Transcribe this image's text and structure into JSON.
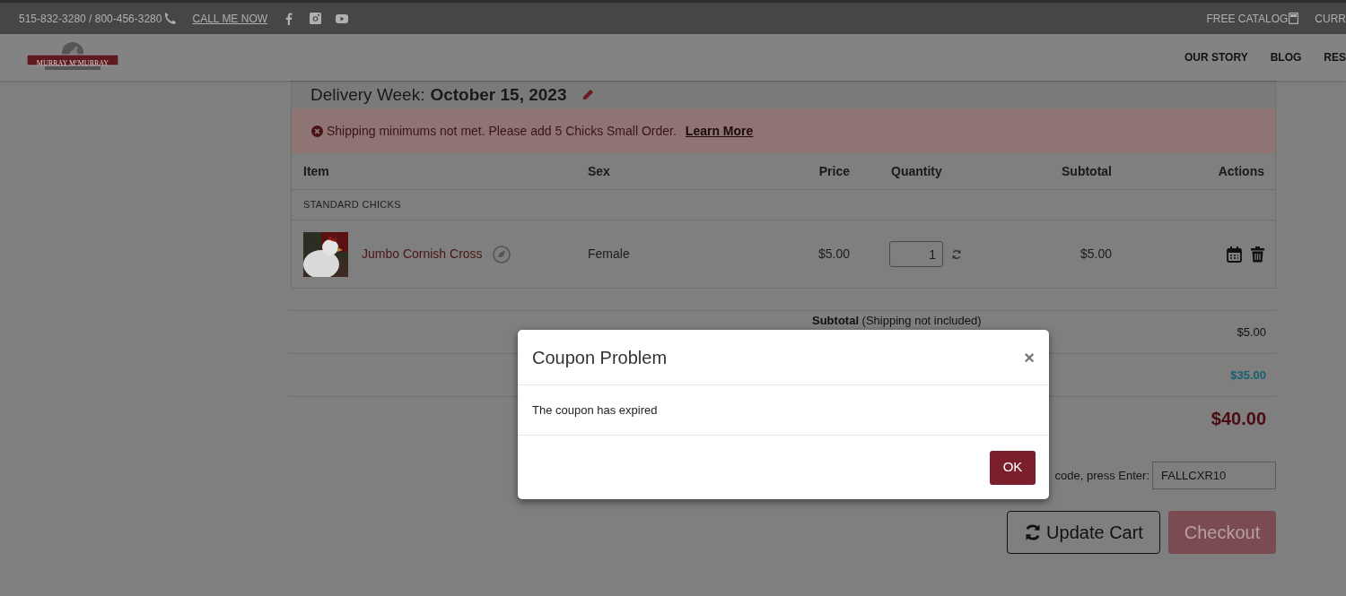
{
  "top_bar": {
    "phone": "515-832-3280 / 800-456-3280",
    "call_link": "CALL ME NOW",
    "catalog_link": "FREE CATALOG",
    "cut_link": "CURR"
  },
  "logo": {
    "text": "MURRAY M$^{c}$MURRAY"
  },
  "nav": [
    "OUR STORY",
    "BLOG",
    "RES"
  ],
  "cart": {
    "delivery_label": "Delivery Week:",
    "delivery_date": "October 15, 2023",
    "alert": {
      "message": "Shipping minimums not met. Please add 5 Chicks Small Order.",
      "link": "Learn More"
    },
    "columns": [
      "Item",
      "Sex",
      "Price",
      "Quantity",
      "Subtotal",
      "Actions"
    ],
    "category": "STANDARD CHICKS",
    "rows": [
      {
        "name": "Jumbo Cornish Cross",
        "sex": "Female",
        "price": "$5.00",
        "quantity": "1",
        "subtotal": "$5.00"
      }
    ]
  },
  "summary": [
    {
      "kind": "plain",
      "label": "**Subtotal** (Shipping not included)",
      "value": "$5.00"
    },
    {
      "kind": "shipping",
      "value": "$35.00"
    },
    {
      "kind": "total",
      "value": "$40.00"
    }
  ],
  "coupon": {
    "label": "code, press Enter:",
    "value": "FALLCXR10"
  },
  "buttons": [
    {
      "kind": "update",
      "label": "Update Cart",
      "disabled": false
    },
    {
      "kind": "checkout",
      "label": "Checkout",
      "disabled": true
    }
  ],
  "modal": {
    "title": "Coupon Problem",
    "close": "×",
    "message": "The coupon has expired",
    "button": "OK"
  }
}
